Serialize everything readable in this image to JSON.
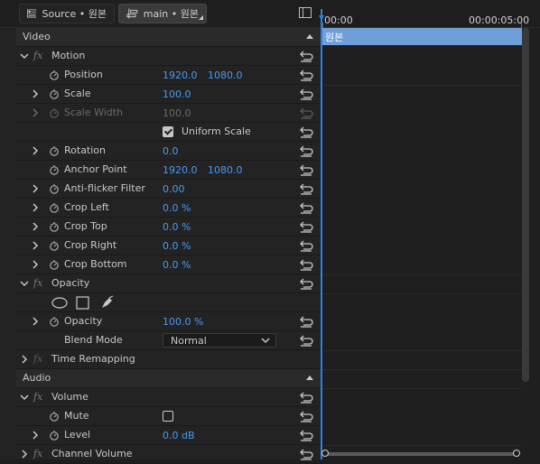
{
  "tabs": {
    "source_label": "Source • 원본",
    "main_label": "main • 원본"
  },
  "sections": {
    "video": "Video",
    "audio": "Audio"
  },
  "rows": {
    "motion": "Motion",
    "position": {
      "label": "Position",
      "x": "1920.0",
      "y": "1080.0"
    },
    "scale": {
      "label": "Scale",
      "value": "100.0"
    },
    "scale_width": {
      "label": "Scale Width",
      "value": "100.0"
    },
    "uniform_scale": {
      "label": "Uniform Scale",
      "checked": true
    },
    "rotation": {
      "label": "Rotation",
      "value": "0.0"
    },
    "anchor_point": {
      "label": "Anchor Point",
      "x": "1920.0",
      "y": "1080.0"
    },
    "anti_flicker": {
      "label": "Anti-flicker Filter",
      "value": "0.00"
    },
    "crop_left": {
      "label": "Crop Left",
      "value": "0.0 %"
    },
    "crop_top": {
      "label": "Crop Top",
      "value": "0.0 %"
    },
    "crop_right": {
      "label": "Crop Right",
      "value": "0.0 %"
    },
    "crop_bottom": {
      "label": "Crop Bottom",
      "value": "0.0 %"
    },
    "opacity_effect": "Opacity",
    "opacity": {
      "label": "Opacity",
      "value": "100.0 %"
    },
    "blend_mode": {
      "label": "Blend Mode",
      "value": "Normal"
    },
    "time_remapping": "Time Remapping",
    "volume": "Volume",
    "mute": {
      "label": "Mute",
      "checked": false
    },
    "level": {
      "label": "Level",
      "value": "0.0 dB"
    },
    "channel_volume": "Channel Volume"
  },
  "timeline": {
    "start_time": "00:00",
    "end_time": "00:00:05:00",
    "clip_name": "원본"
  },
  "colors": {
    "value_blue": "#4a9af0",
    "clip_blue": "#6f9fd8",
    "playhead_blue": "#2f7fe8"
  }
}
